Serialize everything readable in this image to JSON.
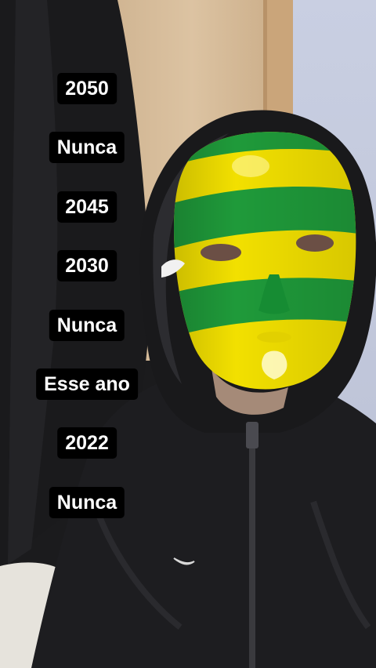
{
  "story": {
    "labels": [
      "2050",
      "Nunca",
      "2045",
      "2030",
      "Nunca",
      "Esse ano",
      "2022",
      "Nunca"
    ]
  },
  "colors": {
    "mask_yellow": "#f2e000",
    "mask_green": "#1f9a3a",
    "hoodie": "#1c1c1e",
    "door": "#d8bd9a",
    "wall": "#c7cde0",
    "label_bg": "#000000",
    "label_text": "#ffffff"
  }
}
